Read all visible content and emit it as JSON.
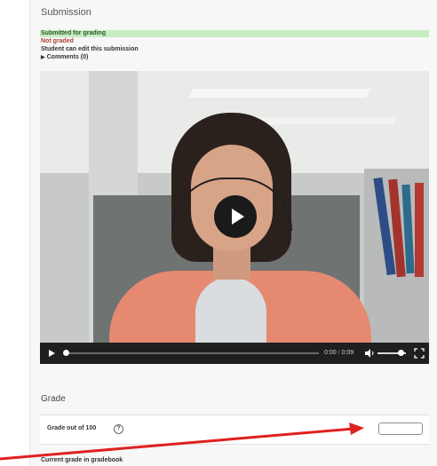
{
  "submission": {
    "title": "Submission",
    "status": "Submitted for grading",
    "grading_status": "Not graded",
    "edit_status": "Student can edit this submission",
    "comments_label": "Comments (0)"
  },
  "video": {
    "current_time": "0:00",
    "separator": "/",
    "duration": "0:09",
    "progress_fraction": 0.0,
    "volume_fraction": 0.8
  },
  "grade": {
    "heading": "Grade",
    "label": "Grade out of 100",
    "input_value": "",
    "current_grade_label": "Current grade in gradebook"
  },
  "colors": {
    "status_bg": "#c7ecc1",
    "not_graded": "#b3443b",
    "annotation_arrow": "#e02020"
  },
  "icons": [
    "play-icon",
    "volume-icon",
    "fullscreen-icon",
    "help-icon",
    "caret-right-icon"
  ]
}
